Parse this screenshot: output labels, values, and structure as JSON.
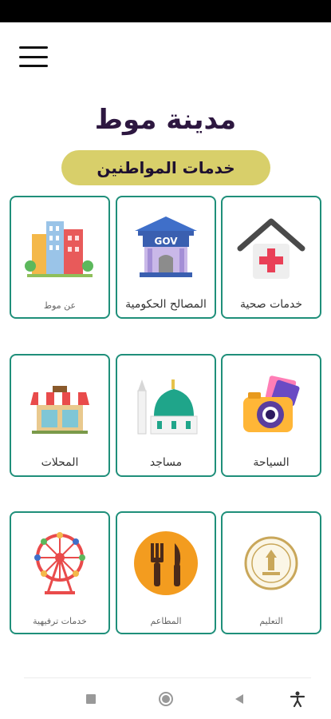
{
  "header": {
    "title": "مدينة موط",
    "subtitle": "خدمات المواطنين",
    "menu_icon": "hamburger-menu-icon"
  },
  "services": [
    {
      "label": "خدمات صحية",
      "icon": "health-house-icon"
    },
    {
      "label": "المصالح الحكومية",
      "icon": "government-building-icon",
      "icon_text": "GOV"
    },
    {
      "label": "عن موط",
      "icon": "city-buildings-icon"
    },
    {
      "label": "السياحة",
      "icon": "camera-photos-icon"
    },
    {
      "label": "مساجد",
      "icon": "mosque-icon"
    },
    {
      "label": "المحلات",
      "icon": "shop-icon"
    },
    {
      "label": "التعليم",
      "icon": "education-seal-icon"
    },
    {
      "label": "المطاعم",
      "icon": "restaurant-fork-knife-icon"
    },
    {
      "label": "خدمات ترفيهية",
      "icon": "ferris-wheel-icon"
    }
  ],
  "navigation": {
    "recents": "square-recents-icon",
    "home": "circle-home-icon",
    "back": "triangle-back-icon",
    "accessibility": "accessibility-person-icon"
  },
  "colors": {
    "card_border": "#1f8f7a",
    "title": "#2d1740",
    "pill": "#d8cf6a"
  }
}
